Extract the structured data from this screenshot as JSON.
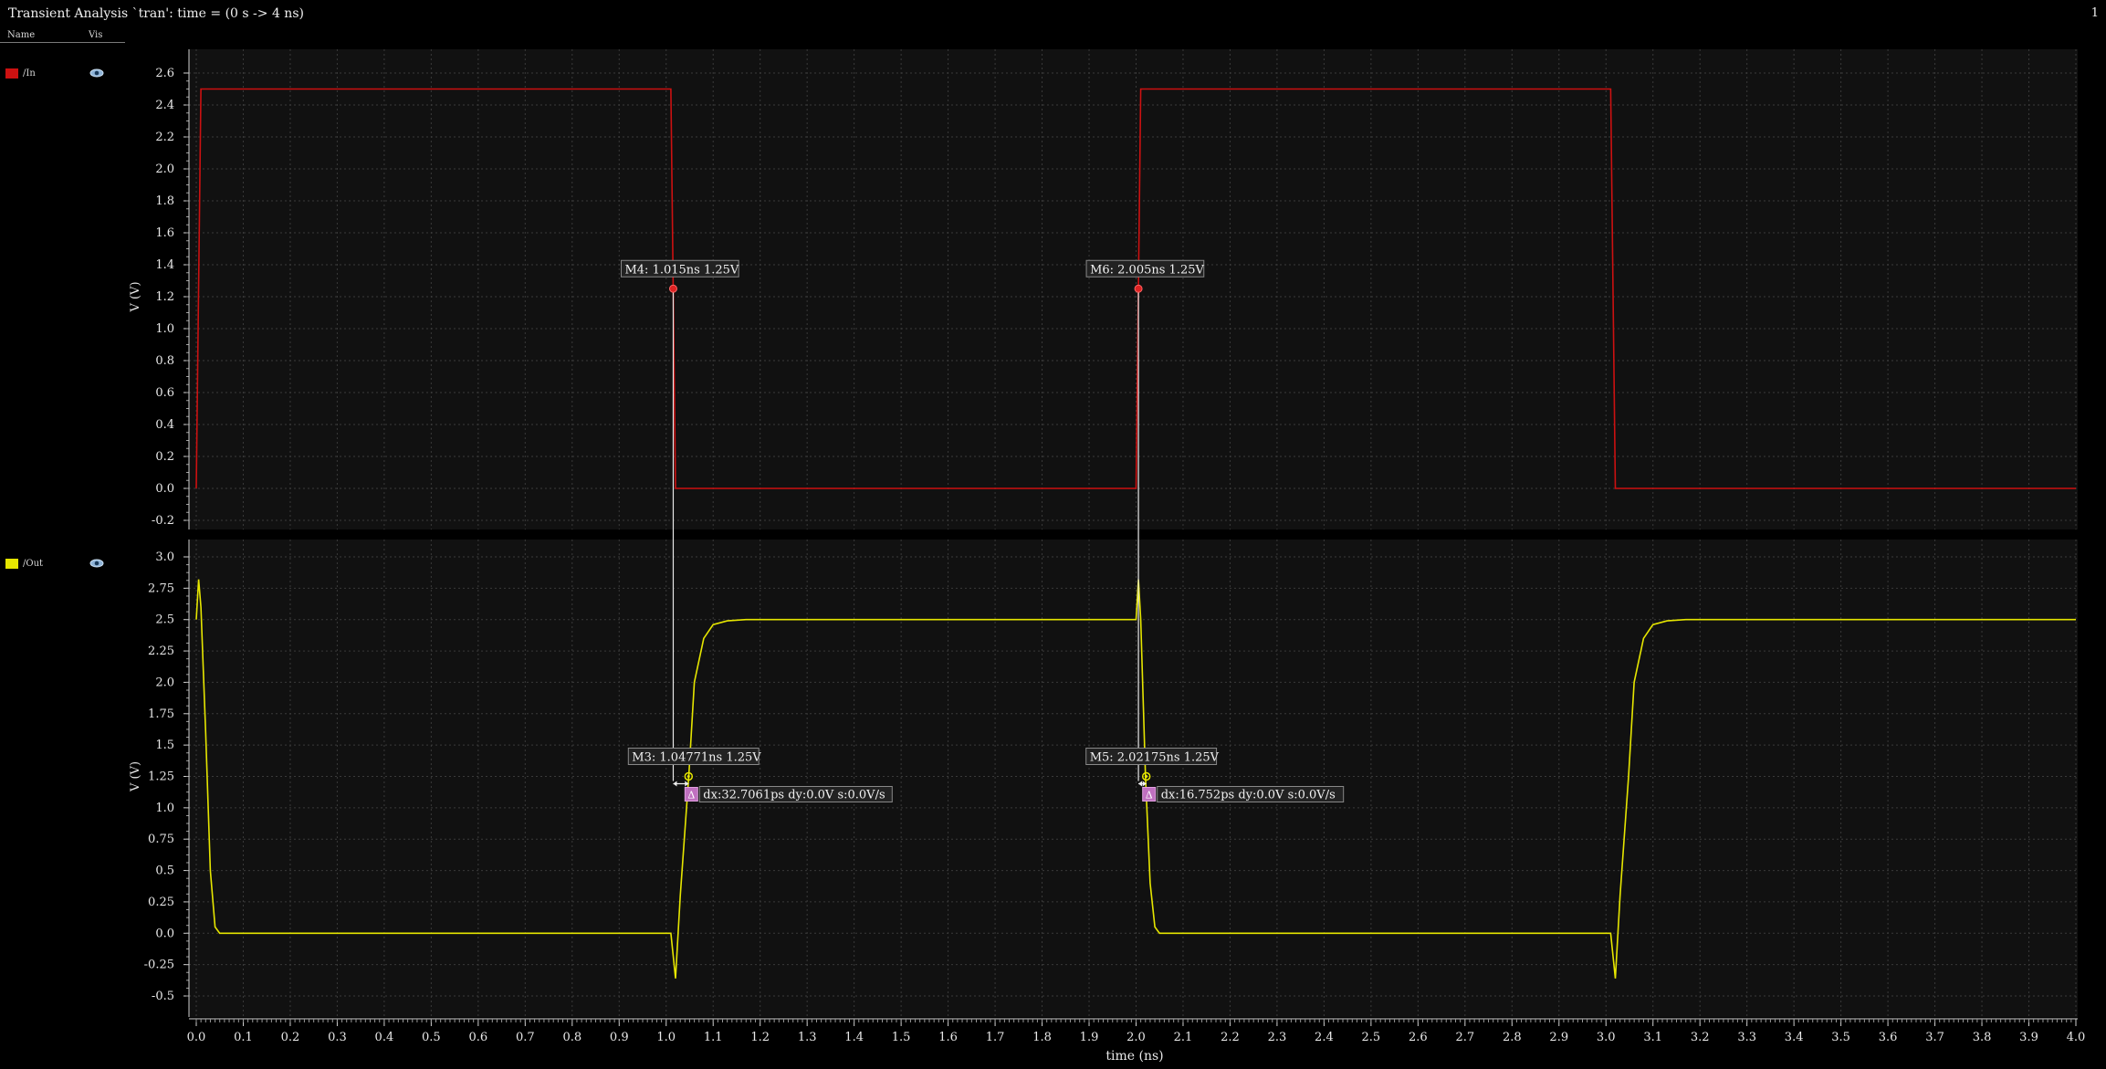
{
  "window": {
    "title": "Transient Analysis `tran': time = (0 s -> 4 ns)",
    "page_number": "1"
  },
  "legend": {
    "name_header": "Name",
    "vis_header": "Vis",
    "signals": [
      {
        "label": "/In",
        "color": "#cc1111",
        "icon": "eye-icon"
      },
      {
        "label": "/Out",
        "color": "#e6e600",
        "icon": "eye-icon"
      }
    ]
  },
  "chart_data": [
    {
      "type": "line",
      "name": "/In",
      "ylabel": "V (V)",
      "ylim": [
        -0.2,
        2.6
      ],
      "yticks": [
        "-0.2",
        "0.0",
        "0.2",
        "0.4",
        "0.6",
        "0.8",
        "1.0",
        "1.2",
        "1.4",
        "1.6",
        "1.8",
        "2.0",
        "2.2",
        "2.4",
        "2.6"
      ],
      "xlim": [
        0,
        4.0
      ],
      "grid": true,
      "series": [
        {
          "name": "/In",
          "color": "#cc1111",
          "x": [
            0.0,
            0.01,
            1.01,
            1.02,
            2.0,
            2.01,
            3.01,
            3.02,
            4.0
          ],
          "y": [
            0.0,
            2.5,
            2.5,
            0.0,
            0.0,
            2.5,
            2.5,
            0.0,
            0.0
          ]
        }
      ],
      "markers": [
        {
          "label": "M4: 1.015ns 1.25V",
          "x": 1.015,
          "y": 1.25
        },
        {
          "label": "M6: 2.005ns 1.25V",
          "x": 2.005,
          "y": 1.25
        }
      ]
    },
    {
      "type": "line",
      "name": "/Out",
      "ylabel": "V (V)",
      "ylim": [
        -0.5,
        3.0
      ],
      "yticks": [
        "-0.5",
        "-0.25",
        "0.0",
        "0.25",
        "0.5",
        "0.75",
        "1.0",
        "1.25",
        "1.5",
        "1.75",
        "2.0",
        "2.25",
        "2.5",
        "2.75",
        "3.0"
      ],
      "xlim": [
        0,
        4.0
      ],
      "grid": true,
      "series": [
        {
          "name": "/Out",
          "color": "#e6e600",
          "x": [
            0.0,
            0.005,
            0.01,
            0.02,
            0.03,
            0.04,
            0.05,
            0.06,
            1.01,
            1.02,
            1.03,
            1.048,
            1.06,
            1.08,
            1.1,
            1.13,
            1.17,
            1.25,
            2.0,
            2.005,
            2.01,
            2.02,
            2.03,
            2.04,
            2.05,
            2.06,
            3.01,
            3.02,
            3.03,
            3.048,
            3.06,
            3.08,
            3.1,
            3.13,
            3.17,
            3.25,
            4.0
          ],
          "y": [
            2.5,
            2.82,
            2.6,
            1.6,
            0.5,
            0.05,
            0.0,
            0.0,
            0.0,
            -0.36,
            0.3,
            1.25,
            2.0,
            2.35,
            2.46,
            2.49,
            2.5,
            2.5,
            2.5,
            2.82,
            2.5,
            1.25,
            0.4,
            0.05,
            0.0,
            0.0,
            0.0,
            -0.36,
            0.3,
            1.25,
            2.0,
            2.35,
            2.46,
            2.49,
            2.5,
            2.5,
            2.5
          ]
        }
      ],
      "markers": [
        {
          "label": "M3: 1.04771ns 1.25V",
          "x": 1.04771,
          "y": 1.25
        },
        {
          "label": "M5: 2.02175ns 1.25V",
          "x": 2.02175,
          "y": 1.25
        }
      ],
      "deltas": [
        {
          "label": "dx:32.7061ps dy:0.0V s:0.0V/s",
          "x1": 1.015,
          "x2": 1.04771,
          "y": 1.25
        },
        {
          "label": "dx:16.752ps dy:0.0V s:0.0V/s",
          "x1": 2.005,
          "x2": 2.02175,
          "y": 1.25
        }
      ]
    }
  ],
  "x_axis": {
    "label": "time (ns)",
    "ticks": [
      "0.0",
      "0.1",
      "0.2",
      "0.3",
      "0.4",
      "0.5",
      "0.6",
      "0.7",
      "0.8",
      "0.9",
      "1.0",
      "1.1",
      "1.2",
      "1.3",
      "1.4",
      "1.5",
      "1.6",
      "1.7",
      "1.8",
      "1.9",
      "2.0",
      "2.1",
      "2.2",
      "2.3",
      "2.4",
      "2.5",
      "2.6",
      "2.7",
      "2.8",
      "2.9",
      "3.0",
      "3.1",
      "3.2",
      "3.3",
      "3.4",
      "3.5",
      "3.6",
      "3.7",
      "3.8",
      "3.9",
      "4.0"
    ]
  }
}
